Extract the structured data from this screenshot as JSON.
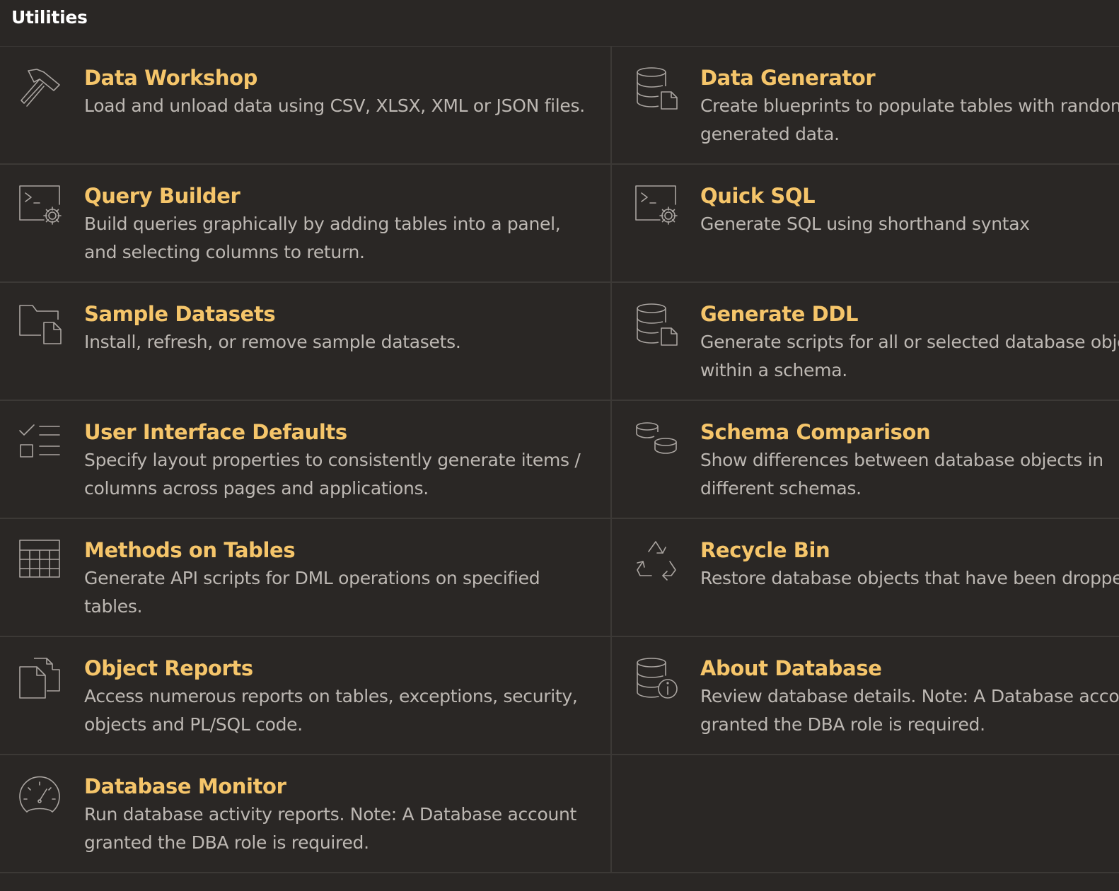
{
  "header": {
    "title": "Utilities"
  },
  "tiles": [
    {
      "title": "Data Workshop",
      "desc": "Load and unload data using CSV, XLSX, XML or JSON files.",
      "icon": "hammer-icon"
    },
    {
      "title": "Data Generator",
      "desc": "Create blueprints to populate tables with randomly",
      "desc2": "generated data.",
      "icon": "database-file-icon"
    },
    {
      "title": "Query Builder",
      "desc": "Build queries graphically by adding tables into a panel, and selecting columns to return.",
      "icon": "terminal-gear-icon"
    },
    {
      "title": "Quick SQL",
      "desc": "Generate SQL using shorthand syntax",
      "icon": "terminal-gear-icon"
    },
    {
      "title": "Sample Datasets",
      "desc": "Install, refresh, or remove sample datasets.",
      "icon": "folder-file-icon"
    },
    {
      "title": "Generate DDL",
      "desc": "Generate scripts for all or selected database objects",
      "desc2": "within a schema.",
      "icon": "database-file-icon"
    },
    {
      "title": "User Interface Defaults",
      "desc": "Specify layout properties to consistently generate items / columns across pages and applications.",
      "icon": "checklist-icon"
    },
    {
      "title": "Schema Comparison",
      "desc": "Show differences between database objects in",
      "desc2": "different schemas.",
      "icon": "compare-databases-icon"
    },
    {
      "title": "Methods on Tables",
      "desc": "Generate API scripts for DML operations on specified tables.",
      "icon": "table-grid-icon"
    },
    {
      "title": "Recycle Bin",
      "desc": "Restore database objects that have been dropped.",
      "icon": "recycle-icon"
    },
    {
      "title": "Object Reports",
      "desc": "Access numerous reports on tables, exceptions, security, objects and PL/SQL code.",
      "icon": "documents-icon"
    },
    {
      "title": "About Database",
      "desc": "Review database details. Note: A Database account",
      "desc2": "granted the DBA role is required.",
      "icon": "database-info-icon"
    },
    {
      "title": "Database Monitor",
      "desc": "Run database activity reports. Note: A Database account granted the DBA role is required.",
      "icon": "gauge-icon"
    }
  ]
}
